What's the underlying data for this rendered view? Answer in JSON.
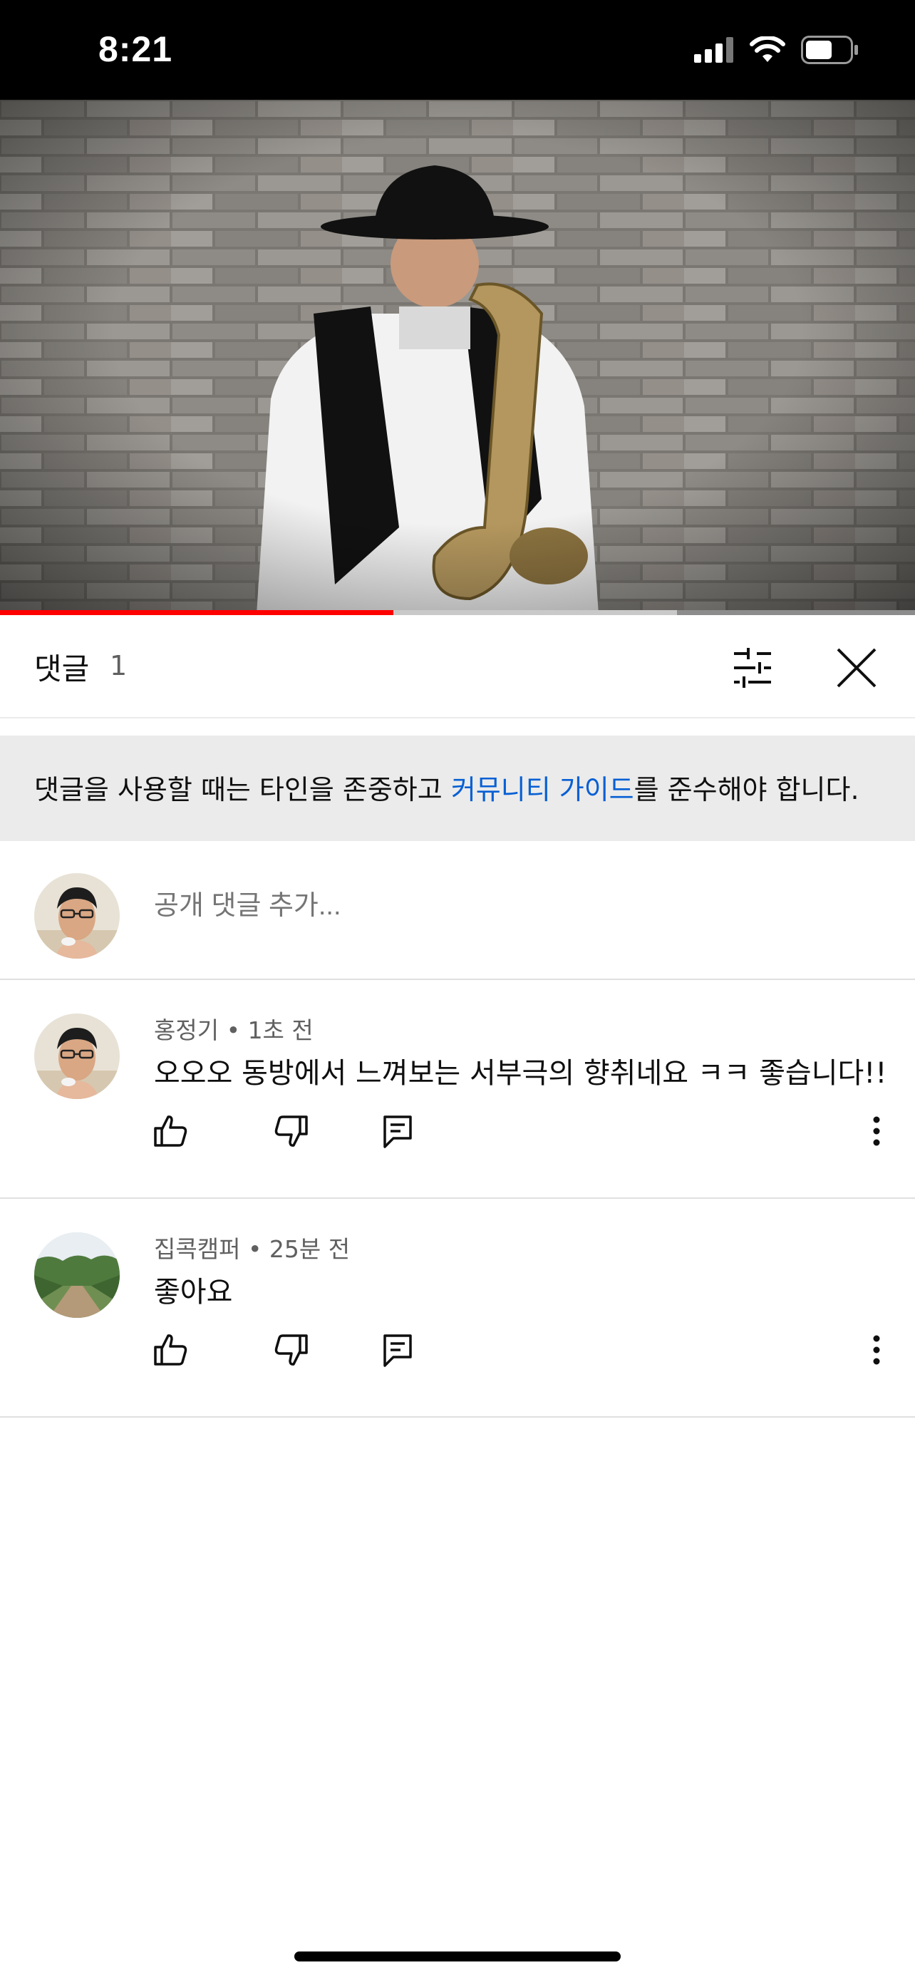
{
  "status_bar": {
    "time": "8:21",
    "icons": [
      "cellular-signal-icon",
      "wifi-icon",
      "battery-icon"
    ]
  },
  "video": {
    "progress": 0.43,
    "buffered": 0.74
  },
  "comments_panel": {
    "title": "댓글",
    "count": "1",
    "sort_icon": "sort-icon",
    "close_icon": "close-icon"
  },
  "guideline": {
    "text_before": "댓글을 사용할 때는 타인을 존중하고 ",
    "link_text": "커뮤니티 가이드",
    "text_after": "를 준수해야 합니다."
  },
  "add_comment": {
    "placeholder": "공개 댓글 추가..."
  },
  "comments": [
    {
      "author": "홍정기",
      "time": "1초 전",
      "separator": "•",
      "text": "오오오 동방에서 느껴보는 서부극의 향취네요 ㅋㅋ 좋습니다!!"
    },
    {
      "author": "집콕캠퍼",
      "time": "25분 전",
      "separator": "•",
      "text": "좋아요"
    }
  ],
  "colors": {
    "link": "#065fd4",
    "progress_played": "#ff0000",
    "banner_bg": "#ebebeb"
  }
}
